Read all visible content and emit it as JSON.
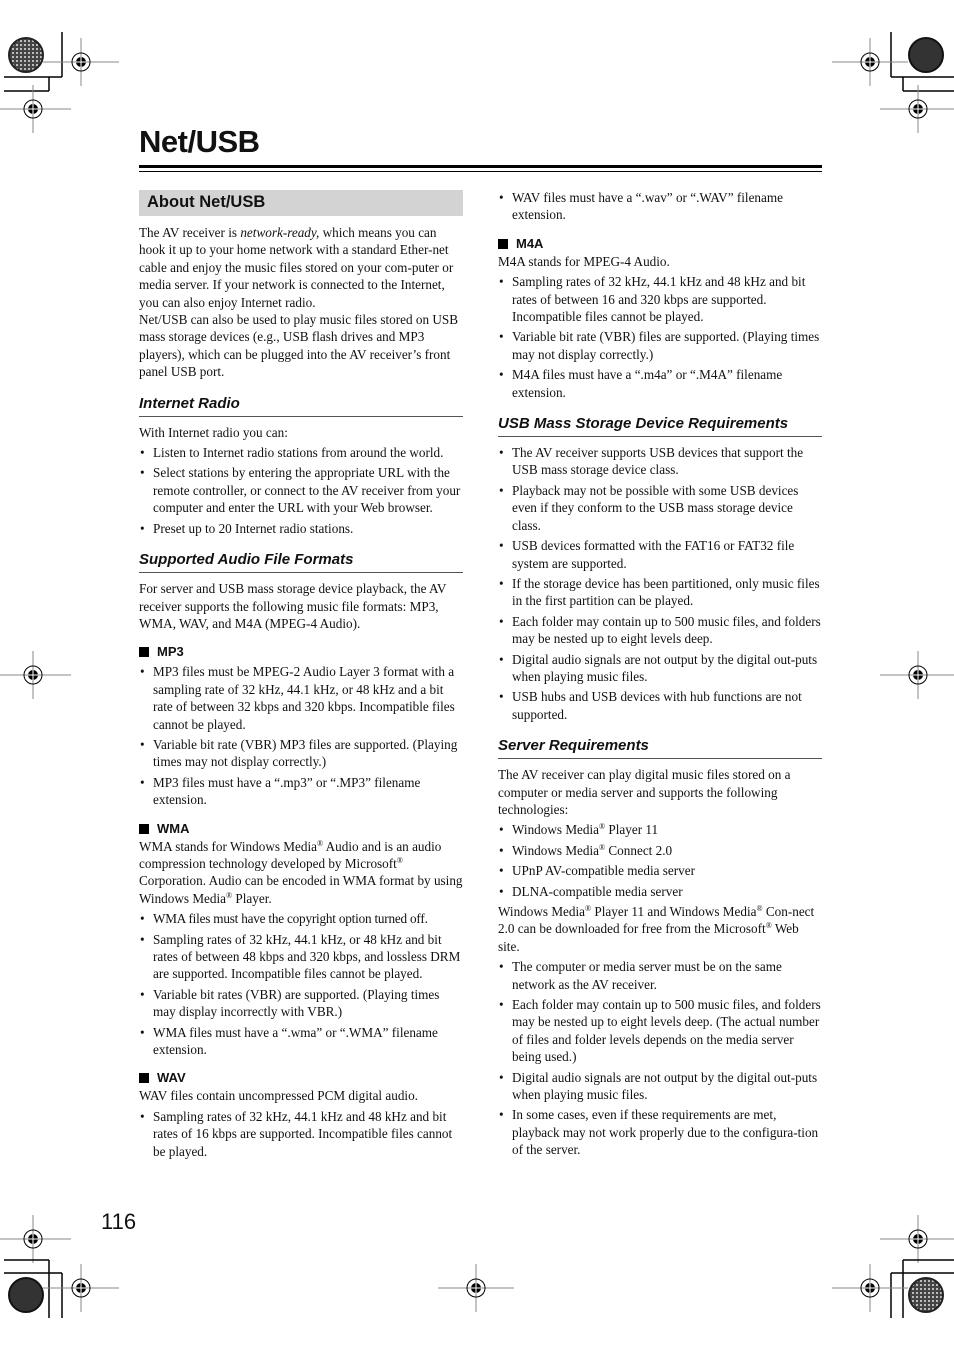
{
  "page": {
    "title": "Net/USB",
    "page_number": "116"
  },
  "about": {
    "heading": "About Net/USB",
    "para1_a": "The AV receiver is ",
    "para1_em": "network-ready,",
    "para1_b": " which means you can hook it up to your home network with a standard Ether-net cable and enjoy the music files stored on your com-puter or media server. If your network is connected to the Internet, you can also enjoy Internet radio.",
    "para2": "Net/USB can also be used to play music files stored on USB mass storage devices (e.g., USB flash drives and MP3 players), which can be plugged into the AV receiver’s front panel USB port."
  },
  "internet_radio": {
    "heading": "Internet Radio",
    "intro": "With Internet radio you can:",
    "bullets": [
      "Listen to Internet radio stations from around the world.",
      "Select stations by entering the appropriate URL with the remote controller, or connect to the AV receiver from your computer and enter the URL with your Web browser.",
      "Preset up to 20 Internet radio stations."
    ]
  },
  "formats": {
    "heading": "Supported Audio File Formats",
    "intro": "For server and USB mass storage device playback, the AV receiver supports the following music file formats: MP3, WMA, WAV, and M4A (MPEG-4 Audio).",
    "mp3": {
      "label": "MP3",
      "bullets": [
        "MP3 files must be MPEG-2 Audio Layer 3 format with a sampling rate of 32 kHz, 44.1 kHz, or 48 kHz and a bit rate of between 32 kbps and 320 kbps. Incompatible files cannot be played.",
        "Variable bit rate (VBR) MP3 files are supported. (Playing times may not display correctly.)",
        "MP3 files must have a “.mp3” or “.MP3” filename extension."
      ]
    },
    "wma": {
      "label": "WMA",
      "intro_1": "WMA stands for Windows Media",
      "intro_2": " Audio and is an audio compression technology developed by Microsoft",
      "intro_3": " Corporation. Audio can be encoded in WMA format by using Windows Media",
      "intro_4": " Player.",
      "reg": "®",
      "bullets": [
        "WMA files must have the copyright option turned off.",
        "Sampling rates of 32 kHz, 44.1 kHz, or 48 kHz and bit rates of between 48 kbps and 320 kbps, and lossless DRM are supported. Incompatible files cannot be played.",
        "Variable bit rates (VBR) are supported. (Playing times may display incorrectly with VBR.)",
        "WMA files must have a “.wma” or “.WMA” filename extension."
      ]
    },
    "wav": {
      "label": "WAV",
      "intro": "WAV files contain uncompressed PCM digital audio.",
      "bullets": [
        "Sampling rates of 32 kHz, 44.1 kHz and 48 kHz and bit rates of 16 kbps are supported. Incompatible files cannot be played.",
        "WAV files must have a “.wav” or “.WAV” filename extension."
      ]
    },
    "m4a": {
      "label": "M4A",
      "intro": "M4A stands for MPEG-4 Audio.",
      "bullets": [
        "Sampling rates of 32 kHz, 44.1 kHz and 48 kHz and bit rates of between 16 and 320 kbps are supported. Incompatible files cannot be played.",
        "Variable bit rate (VBR) files are supported. (Playing times may not display correctly.)",
        "M4A files must have a “.m4a” or “.M4A” filename extension."
      ]
    }
  },
  "usb_requirements": {
    "heading": "USB Mass Storage Device Requirements",
    "bullets": [
      "The AV receiver supports USB devices that support the USB mass storage device class.",
      "Playback may not be possible with some USB devices even if they conform to the USB mass storage device class.",
      "USB devices formatted with the FAT16 or FAT32 file system are supported.",
      "If the storage device has been partitioned, only music files in the first partition can be played.",
      "Each folder may contain up to 500 music files, and folders may be nested up to eight levels deep.",
      "Digital audio signals are not output by the digital out-puts when playing music files.",
      "USB hubs and USB devices with hub functions are not supported."
    ]
  },
  "server_requirements": {
    "heading": "Server Requirements",
    "intro": "The AV receiver can play digital music files stored on a computer or media server and supports the following technologies:",
    "tech": {
      "wmp_a": "Windows Media",
      "wmp_b": " Player 11",
      "wmc_a": "Windows Media",
      "wmc_b": " Connect 2.0",
      "upnp": "UPnP AV-compatible media server",
      "dlna": "DLNA-compatible media server"
    },
    "download_1": "Windows Media",
    "download_2": " Player 11 and Windows Media",
    "download_3": " Con-nect 2.0 can be downloaded for free from the Microsoft",
    "download_4": " Web site.",
    "reg": "®",
    "bullets": [
      "The computer or media server must be on the same network as the AV receiver.",
      "Each folder may contain up to 500 music files, and folders may be nested up to eight levels deep. (The actual number of files and folder levels depends on the media server being used.)",
      "Digital audio signals are not output by the digital out-puts when playing music files.",
      "In some cases, even if these requirements are met, playback may not work properly due to the configura-tion of the server."
    ]
  },
  "print_marks": {
    "registration_icon": "registration-target-icon",
    "color_wheel_icon": "color-wheel-icon"
  }
}
